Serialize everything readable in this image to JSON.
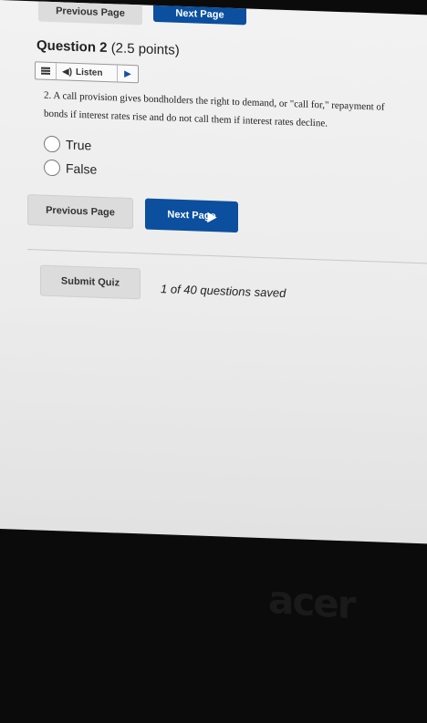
{
  "top_nav": {
    "prev_label": "Previous Page",
    "next_label": "Next Page"
  },
  "question": {
    "heading": "Question 2",
    "points": "(2.5 points)",
    "text_line1": "2. A call provision gives bondholders the right to demand, or \"call for,\" repayment of",
    "text_line2": "bonds if interest rates rise and do not call them if interest rates decline.",
    "options": [
      {
        "label": "True"
      },
      {
        "label": "False"
      }
    ]
  },
  "listen": {
    "label": "Listen"
  },
  "nav": {
    "prev_label": "Previous Page",
    "next_label": "Next Page"
  },
  "submit": {
    "label": "Submit Quiz",
    "status": "1 of 40 questions saved"
  },
  "bezel": {
    "brand": "acer"
  },
  "colors": {
    "primary": "#0b4f9e",
    "button_gray": "#dcdcdc"
  },
  "icons": [
    "menu-icon",
    "speaker-icon",
    "play-icon",
    "radio-icon"
  ]
}
